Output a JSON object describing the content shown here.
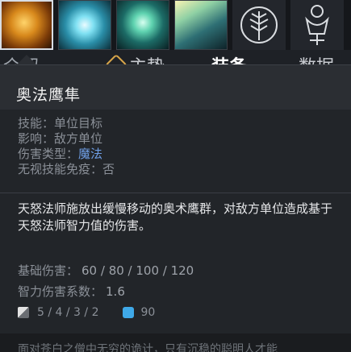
{
  "icons": {
    "abilities": [
      {
        "name": "ability-1",
        "selected": true
      },
      {
        "name": "ability-2",
        "selected": false
      },
      {
        "name": "ability-3",
        "selected": false
      },
      {
        "name": "ability-4",
        "selected": false
      }
    ],
    "talents": [
      "talent-tree-icon",
      "aghanim-icon"
    ]
  },
  "tabs": [
    {
      "label": "介绍",
      "active": false
    },
    {
      "label": "主势",
      "active": false
    },
    {
      "label": "装备",
      "active": true
    },
    {
      "label": "数据",
      "active": false
    }
  ],
  "tooltip": {
    "title": "奥法鹰隼",
    "props": {
      "ability_label": "技能：",
      "ability_value": "单位目标",
      "affects_label": "影响：",
      "affects_value": "敌方单位",
      "damage_type_label": "伤害类型：",
      "damage_type_value": "魔法",
      "pierce_label": "无视技能免疫：",
      "pierce_value": "否"
    },
    "description": "天怒法师施放出缓慢移动的奥术鹰群，对敌方单位造成基于天怒法师智力值的伤害。",
    "stats": {
      "base_damage_label": "基础伤害：",
      "base_damage_value": "60 / 80 / 100 / 120",
      "int_multiplier_label": "智力伤害系数：",
      "int_multiplier_value": "1.6"
    },
    "costs": {
      "cooldown": "5 / 4 / 3 / 2",
      "mana": "90"
    },
    "lore": "面对苍白之僧中无穷的诡计，只有沉稳的聪明人才能"
  },
  "colors": {
    "magic_damage": "#6f9fe6",
    "mana": "#3fa9e8",
    "tab_accent": "#d7a54a"
  }
}
